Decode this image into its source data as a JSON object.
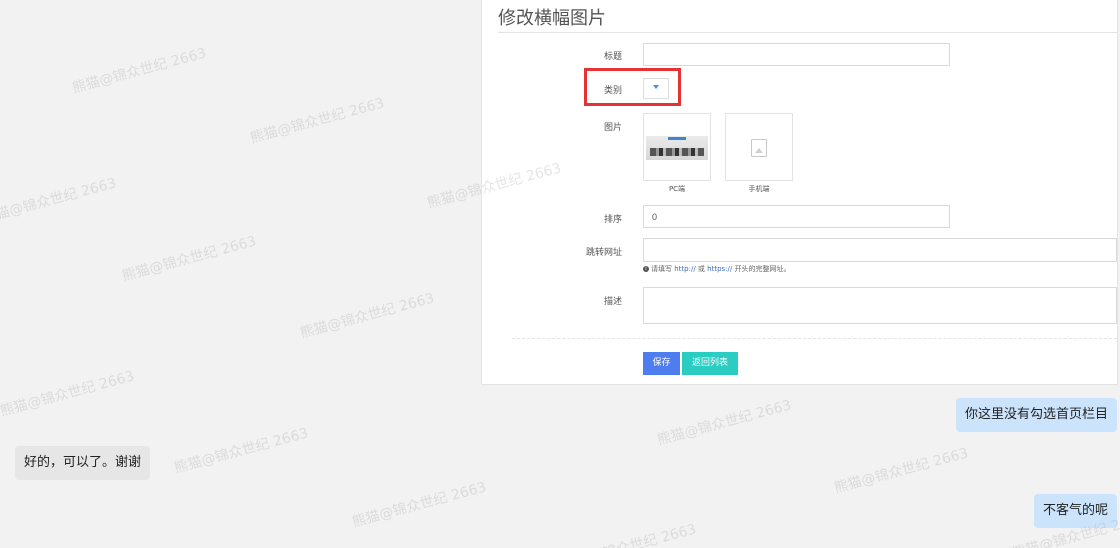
{
  "watermark_text": "熊猫@锦众世纪 2663",
  "form": {
    "title": "修改横幅图片",
    "fields": {
      "title_label": "标题",
      "title_value": "",
      "category_label": "类别",
      "image_label": "图片",
      "pc_caption": "PC端",
      "mobile_caption": "手机端",
      "sort_label": "排序",
      "sort_value": "0",
      "url_label": "跳转网址",
      "url_value": "",
      "url_help_prefix": "请填写",
      "url_help_http": "http://",
      "url_help_or": "或",
      "url_help_https": "https://",
      "url_help_suffix": "开头的完整网址。",
      "desc_label": "描述",
      "desc_value": ""
    },
    "buttons": {
      "save": "保存",
      "back": "返回列表"
    }
  },
  "chat": {
    "msg1": "你这里没有勾选首页栏目",
    "msg2": "好的，可以了。谢谢",
    "msg3": "不客气的呢"
  },
  "colors": {
    "highlight": "#e53333",
    "save_button": "#4e7df0",
    "back_button": "#2bcdc3",
    "bubble_right": "#cce4fb",
    "bubble_left": "#e6e6e6"
  }
}
